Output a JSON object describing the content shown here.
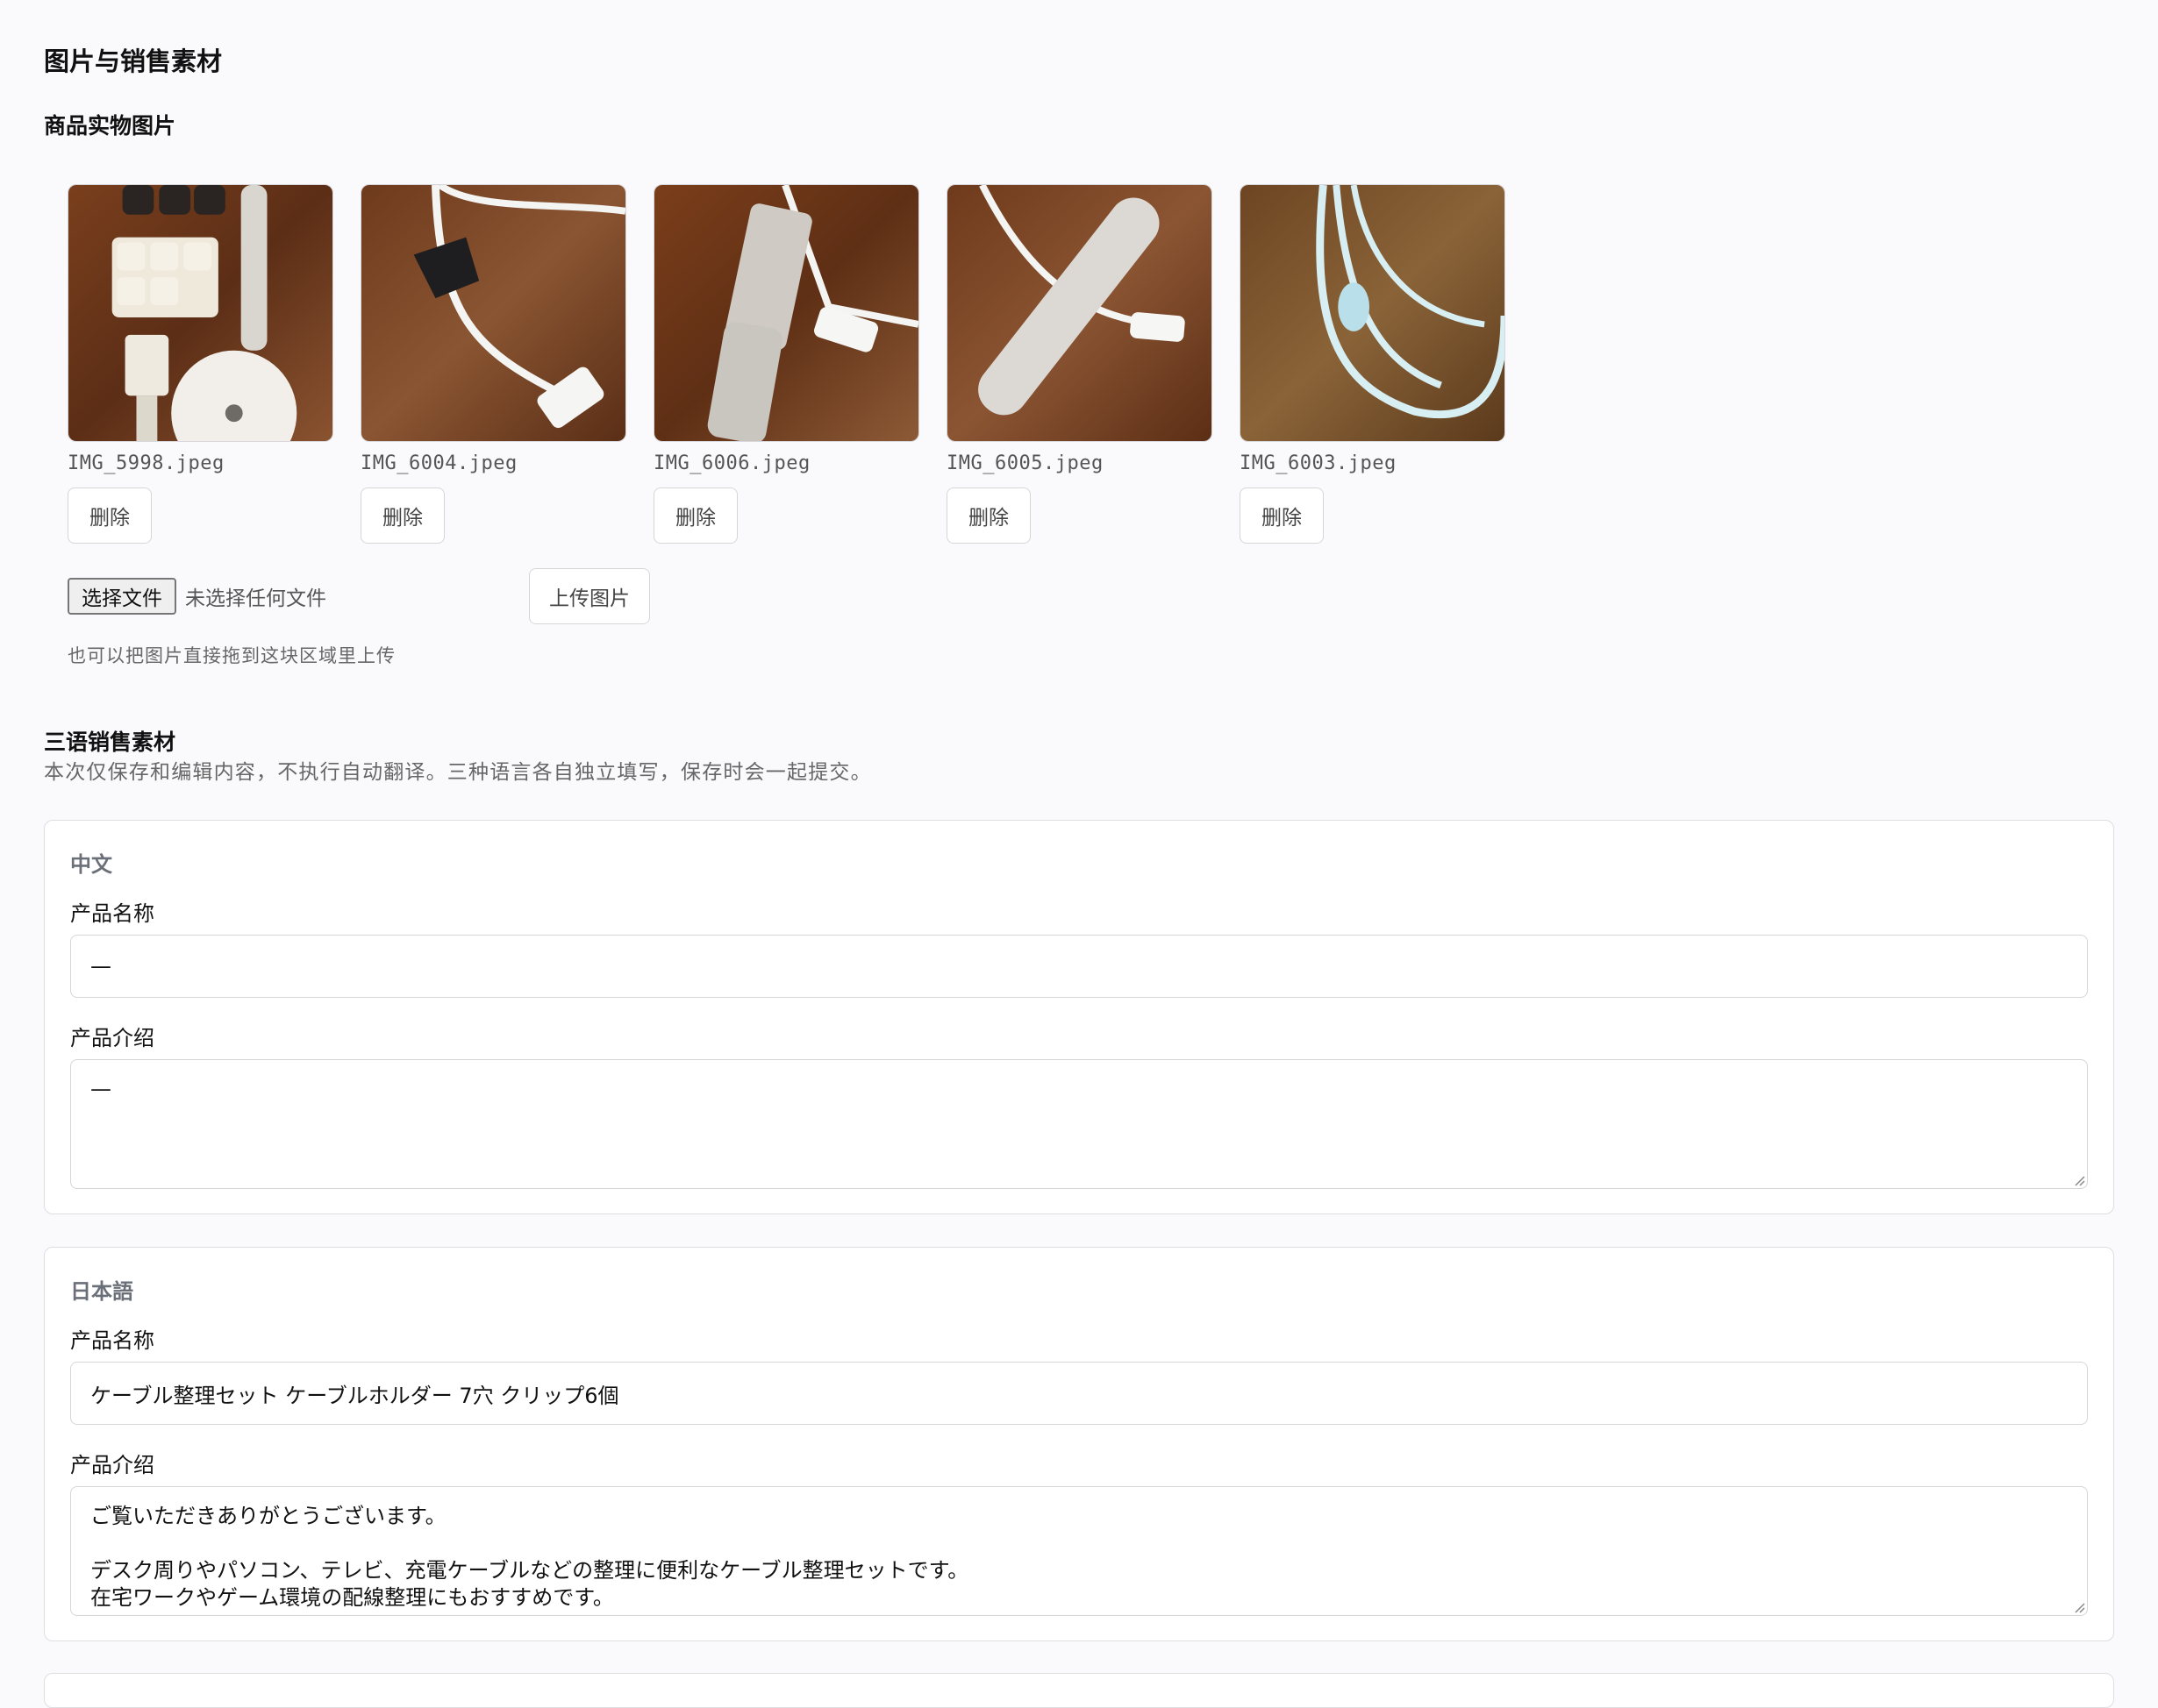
{
  "header": {
    "title": "图片与销售素材",
    "photos_title": "商品实物图片"
  },
  "images": [
    {
      "filename": "IMG_5998.jpeg",
      "delete_label": "删除"
    },
    {
      "filename": "IMG_6004.jpeg",
      "delete_label": "删除"
    },
    {
      "filename": "IMG_6006.jpeg",
      "delete_label": "删除"
    },
    {
      "filename": "IMG_6005.jpeg",
      "delete_label": "删除"
    },
    {
      "filename": "IMG_6003.jpeg",
      "delete_label": "删除"
    }
  ],
  "upload": {
    "choose_file_label": "选择文件",
    "file_status": "未选择任何文件",
    "upload_label": "上传图片",
    "hint": "也可以把图片直接拖到这块区域里上传"
  },
  "materials": {
    "title": "三语销售素材",
    "description": "本次仅保存和编辑内容，不执行自动翻译。三种语言各自独立填写，保存时会一起提交。",
    "languages": [
      {
        "label": "中文",
        "name_label": "产品名称",
        "name_value": "—",
        "desc_label": "产品介绍",
        "desc_lines": [
          "—"
        ]
      },
      {
        "label": "日本語",
        "name_label": "产品名称",
        "name_value": "ケーブル整理セット ケーブルホルダー 7穴 クリップ6個",
        "desc_label": "产品介绍",
        "desc_lines": [
          "ご覧いただきありがとうございます。",
          "",
          "デスク周りやパソコン、テレビ、充電ケーブルなどの整理に便利なケーブル整理セットです。",
          "在宅ワークやゲーム環境の配線整理にもおすすめです。"
        ]
      }
    ]
  }
}
